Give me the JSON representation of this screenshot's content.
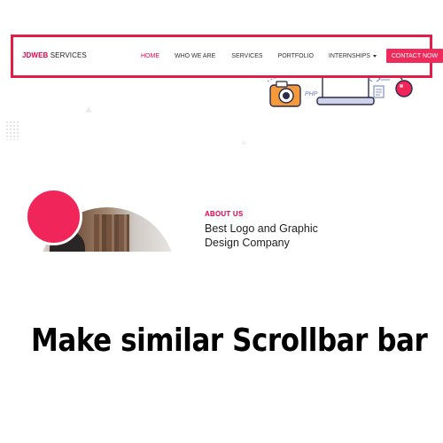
{
  "navbar": {
    "brand_strong": "JDWEB",
    "brand_rest": " SERVICES",
    "items": [
      {
        "label": "HOME",
        "active": true
      },
      {
        "label": "WHO WE ARE"
      },
      {
        "label": "SERVICES"
      },
      {
        "label": "PORTFOLIO"
      },
      {
        "label": "INTERNSHIPS",
        "dropdown": true
      }
    ],
    "contact_label": "CONTACT NOW",
    "highlight_color": "#e11d48",
    "accent_color": "#ef2b5b"
  },
  "hero": {
    "illustration_text": "PHP",
    "icons": [
      "camera-icon",
      "monitor-icon",
      "code-icon",
      "flask-icon",
      "document-icon"
    ]
  },
  "about": {
    "eyebrow": "ABOUT US",
    "heading": "Best Logo and Graphic Design Company"
  },
  "caption": "Make similar Scrollbar bar"
}
